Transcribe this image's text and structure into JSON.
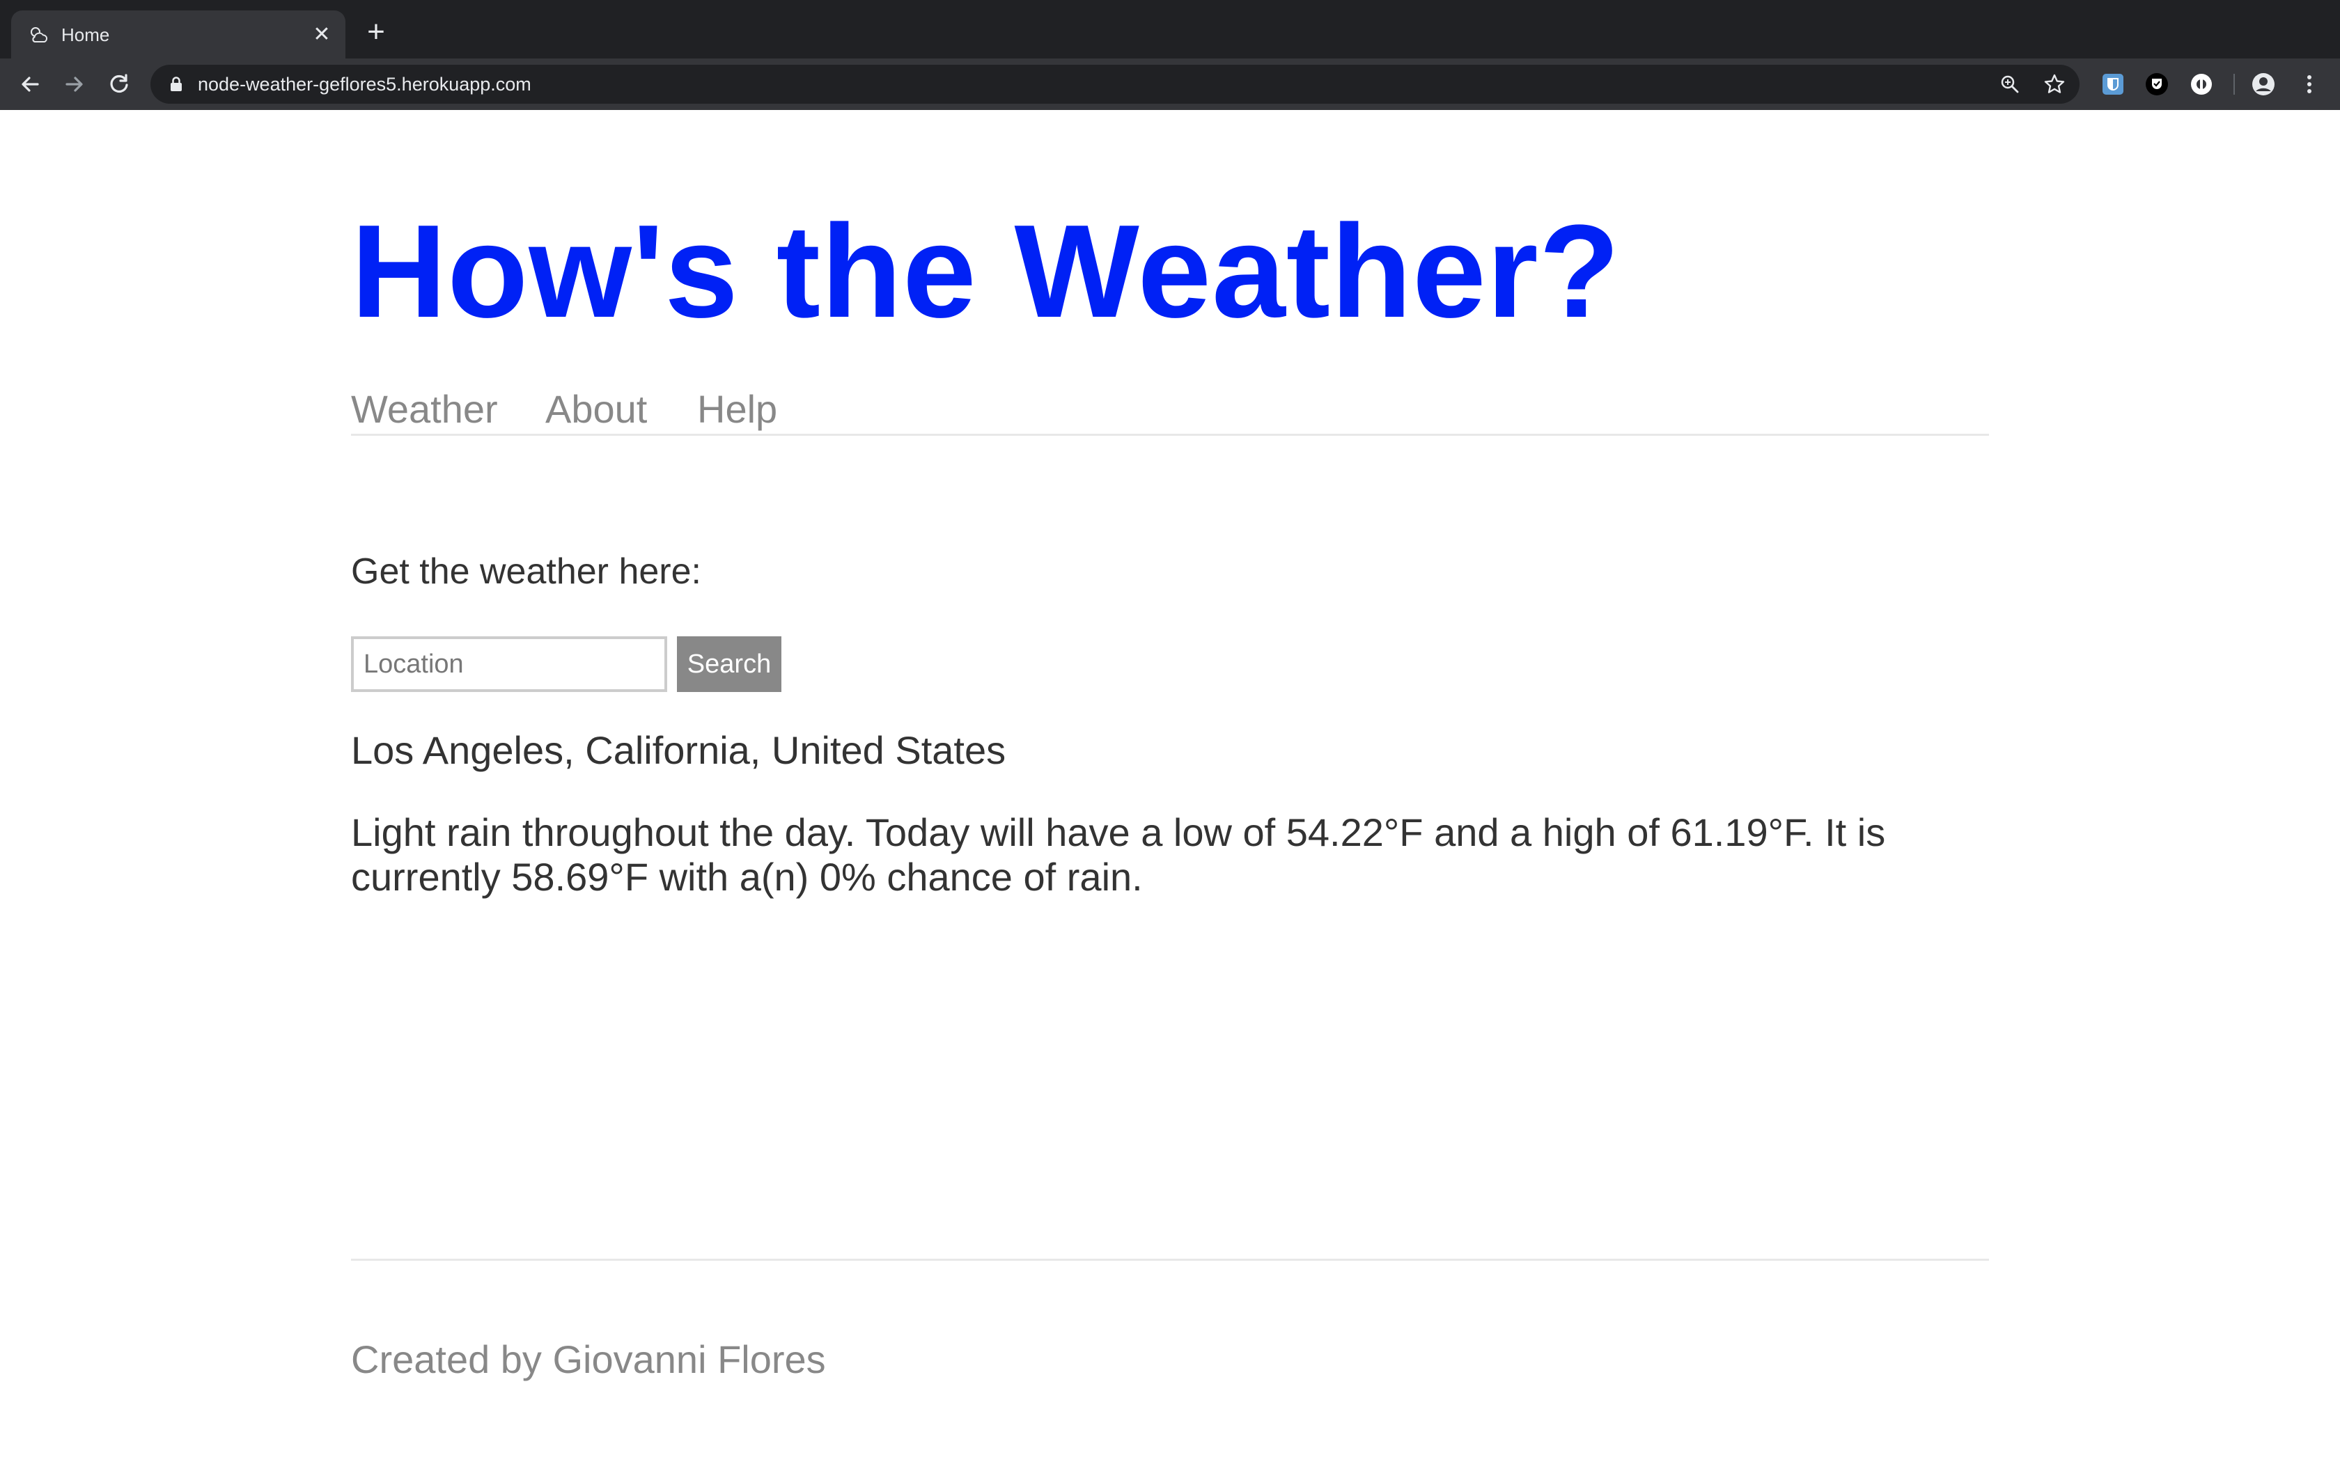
{
  "browser": {
    "tab_title": "Home",
    "tab_close": "✕",
    "new_tab": "+",
    "url": "node-weather-geflores5.herokuapp.com"
  },
  "site": {
    "title": "How's the Weather?",
    "nav": {
      "weather": "Weather",
      "about": "About",
      "help": "Help"
    }
  },
  "search": {
    "prompt": "Get the weather here:",
    "placeholder": "Location",
    "button_label": "Search"
  },
  "forecast": {
    "location": "Los Angeles, California, United States",
    "summary": "Light rain throughout the day. Today will have a low of 54.22°F and a high of 61.19°F. It is currently 58.69°F with a(n) 0% chance of rain."
  },
  "footer": {
    "credit": "Created by Giovanni Flores"
  },
  "colors": {
    "title": "#0021f5",
    "nav_text": "#888888",
    "body_text": "#333333",
    "button_bg": "#888888",
    "chrome_bg": "#202124",
    "toolbar_bg": "#35363a"
  }
}
